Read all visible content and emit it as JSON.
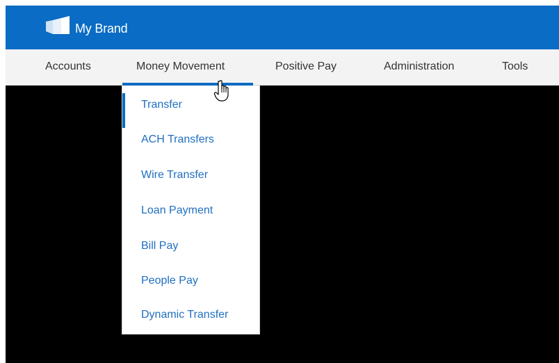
{
  "brand": {
    "name": "My Brand",
    "logo_icon": "brand-logo-icon",
    "color": "#0a6cc4"
  },
  "nav": {
    "items": [
      {
        "label": "Accounts"
      },
      {
        "label": "Money Movement",
        "active": true
      },
      {
        "label": "Positive Pay"
      },
      {
        "label": "Administration"
      },
      {
        "label": "Tools"
      }
    ]
  },
  "dropdown": {
    "items": [
      {
        "label": "Transfer",
        "selected": true
      },
      {
        "label": "ACH Transfers"
      },
      {
        "label": "Wire Transfer"
      },
      {
        "label": "Loan Payment"
      },
      {
        "label": "Bill Pay"
      },
      {
        "label": "People Pay"
      },
      {
        "label": "Dynamic Transfer"
      }
    ],
    "link_color": "#1f6fc1"
  },
  "cursor": {
    "icon": "hand-pointer-icon"
  }
}
